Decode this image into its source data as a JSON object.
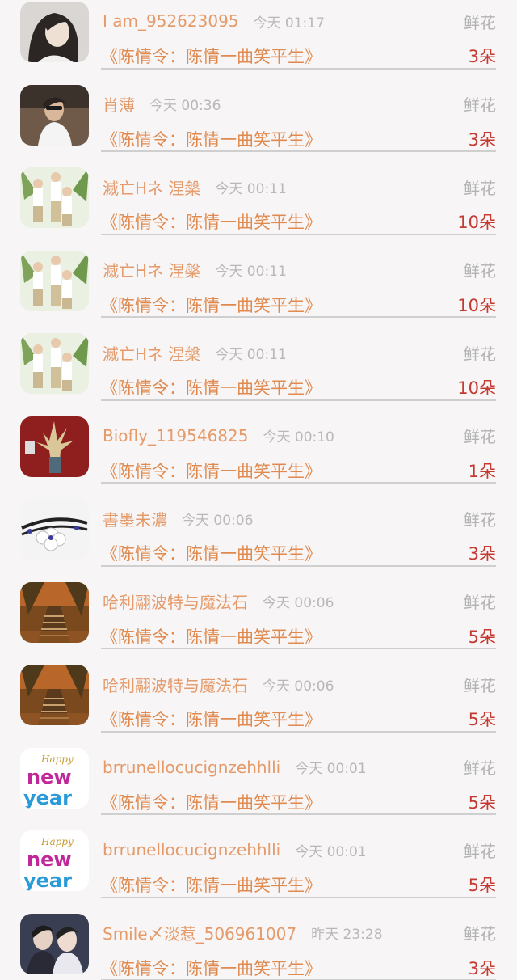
{
  "gift_list": {
    "rows": [
      {
        "username": "I am_952623095",
        "time": "今天 01:17",
        "gift": "鲜花",
        "book": "《陈情令：陈情一曲笑平生》",
        "count": "3朵",
        "avatar": "portrait-girl"
      },
      {
        "username": "肖薄",
        "time": "今天 00:36",
        "gift": "鲜花",
        "book": "《陈情令：陈情一曲笑平生》",
        "count": "3朵",
        "avatar": "selfie-car"
      },
      {
        "username": "滅亡Hネ 涅槃",
        "time": "今天 00:11",
        "gift": "鲜花",
        "book": "《陈情令：陈情一曲笑平生》",
        "count": "10朵",
        "avatar": "group-boys"
      },
      {
        "username": "滅亡Hネ 涅槃",
        "time": "今天 00:11",
        "gift": "鲜花",
        "book": "《陈情令：陈情一曲笑平生》",
        "count": "10朵",
        "avatar": "group-boys"
      },
      {
        "username": "滅亡Hネ 涅槃",
        "time": "今天 00:11",
        "gift": "鲜花",
        "book": "《陈情令：陈情一曲笑平生》",
        "count": "10朵",
        "avatar": "group-boys"
      },
      {
        "username": "Biofly_119546825",
        "time": "今天 00:10",
        "gift": "鲜花",
        "book": "《陈情令：陈情一曲笑平生》",
        "count": "1朵",
        "avatar": "figure-red"
      },
      {
        "username": "書墨未濃",
        "time": "今天 00:06",
        "gift": "鲜花",
        "book": "《陈情令：陈情一曲笑平生》",
        "count": "3朵",
        "avatar": "bracelet"
      },
      {
        "username": "哈利翮波特与魔法石",
        "time": "今天 00:06",
        "gift": "鲜花",
        "book": "《陈情令：陈情一曲笑平生》",
        "count": "5朵",
        "avatar": "autumn-bridge"
      },
      {
        "username": "哈利翮波特与魔法石",
        "time": "今天 00:06",
        "gift": "鲜花",
        "book": "《陈情令：陈情一曲笑平生》",
        "count": "5朵",
        "avatar": "autumn-bridge"
      },
      {
        "username": "brrunellocucignzehhlli",
        "time": "今天 00:01",
        "gift": "鲜花",
        "book": "《陈情令：陈情一曲笑平生》",
        "count": "5朵",
        "avatar": "new-year"
      },
      {
        "username": "brrunellocucignzehhlli",
        "time": "今天 00:01",
        "gift": "鲜花",
        "book": "《陈情令：陈情一曲笑平生》",
        "count": "5朵",
        "avatar": "new-year"
      },
      {
        "username": "Smile〆淡惹_506961007",
        "time": "昨天 23:28",
        "gift": "鲜花",
        "book": "《陈情令：陈情一曲笑平生》",
        "count": "3朵",
        "avatar": "two-men"
      }
    ]
  },
  "colors": {
    "username": "#e59a6a",
    "book": "#e08a4f",
    "count": "#c43a32",
    "muted": "#b3b3b3",
    "background": "#f7f5f5"
  }
}
